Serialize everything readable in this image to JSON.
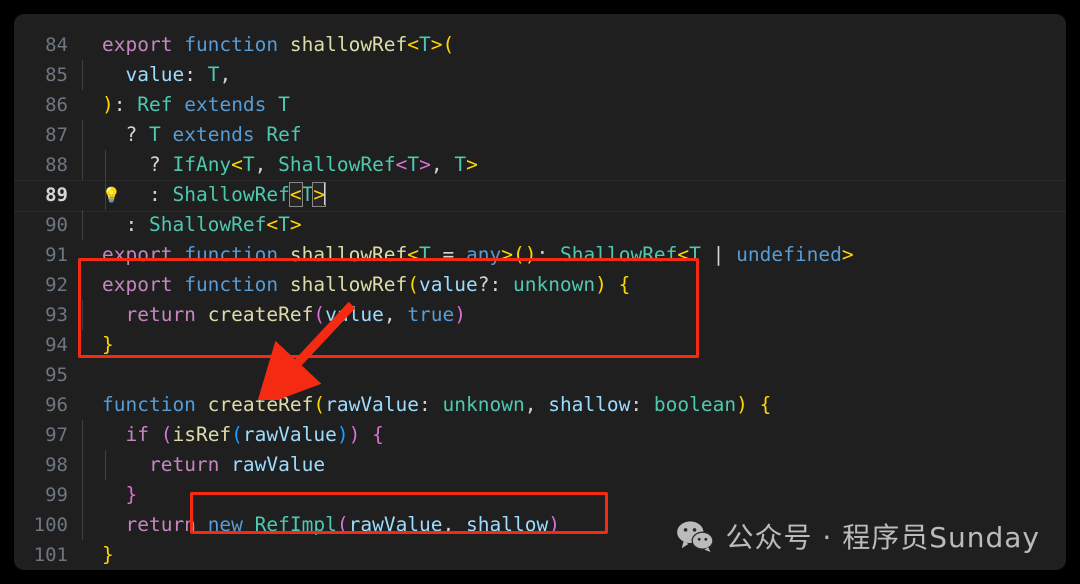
{
  "editor": {
    "theme": "dark-plus",
    "background": "#1f1f1f",
    "active_line": 89,
    "gutter_icon": "lightbulb-icon",
    "lines": [
      {
        "n": "84"
      },
      {
        "n": "85"
      },
      {
        "n": "86"
      },
      {
        "n": "87"
      },
      {
        "n": "88"
      },
      {
        "n": "89"
      },
      {
        "n": "90"
      },
      {
        "n": "91"
      },
      {
        "n": "92"
      },
      {
        "n": "93"
      },
      {
        "n": "94"
      },
      {
        "n": "95"
      },
      {
        "n": "96"
      },
      {
        "n": "97"
      },
      {
        "n": "98"
      },
      {
        "n": "99"
      },
      {
        "n": "100"
      },
      {
        "n": "101"
      }
    ],
    "code": {
      "l84": "export function shallowRef<T>(",
      "l85": "  value: T,",
      "l86": "): Ref extends T",
      "l87": "  ? T extends Ref",
      "l88": "    ? IfAny<T, ShallowRef<T>, T>",
      "l89": "    : ShallowRef<T>",
      "l90": "  : ShallowRef<T>",
      "l91": "export function shallowRef<T = any>(): ShallowRef<T | undefined>",
      "l92": "export function shallowRef(value?: unknown) {",
      "l93": "  return createRef(value, true)",
      "l94": "}",
      "l95": "",
      "l96": "function createRef(rawValue: unknown, shallow: boolean) {",
      "l97": "  if (isRef(rawValue)) {",
      "l98": "    return rawValue",
      "l99": "  }",
      "l100": "  return new RefImpl(rawValue, shallow)",
      "l101": "}"
    },
    "tokens": {
      "export": "export",
      "function": "function",
      "shallowRef": "shallowRef",
      "value": "value",
      "T": "T",
      "Ref": "Ref",
      "extends": "extends",
      "IfAny": "IfAny",
      "ShallowRef": "ShallowRef",
      "any": "any",
      "undefined": "undefined",
      "unknown": "unknown",
      "return": "return",
      "createRef": "createRef",
      "true": "true",
      "rawValue": "rawValue",
      "shallow": "shallow",
      "boolean": "boolean",
      "if": "if",
      "isRef": "isRef",
      "new": "new",
      "RefImpl": "RefImpl",
      "q": "?",
      "colon": ":",
      "comma": ",",
      "pipe": "|",
      "eq": "=",
      "lt": "<",
      "gt": ">",
      "lparen": "(",
      "rparen": ")",
      "lbrace": "{",
      "rbrace": "}",
      "optional": "?:"
    }
  },
  "annotations": {
    "color": "#f42a13",
    "box_function_label": "shallowRef-implementation-box",
    "box_impl_label": "new-RefImpl-box",
    "arrow_label": "createRef-reference-arrow"
  },
  "watermark": {
    "icon": "wechat-icon",
    "text": "公众号 · 程序员Sunday"
  }
}
